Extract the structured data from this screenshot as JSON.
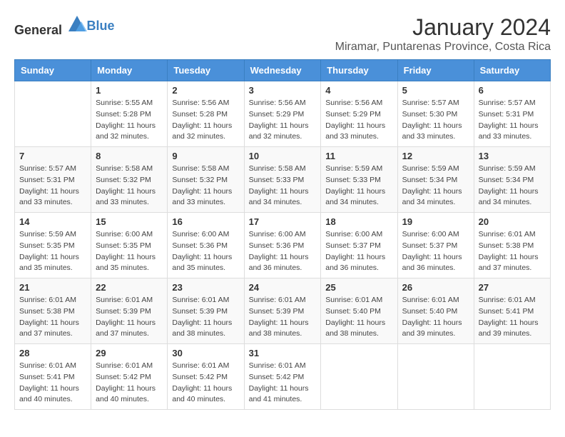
{
  "header": {
    "logo_general": "General",
    "logo_blue": "Blue",
    "month_title": "January 2024",
    "location": "Miramar, Puntarenas Province, Costa Rica"
  },
  "days_of_week": [
    "Sunday",
    "Monday",
    "Tuesday",
    "Wednesday",
    "Thursday",
    "Friday",
    "Saturday"
  ],
  "weeks": [
    [
      {
        "day": "",
        "info": ""
      },
      {
        "day": "1",
        "info": "Sunrise: 5:55 AM\nSunset: 5:28 PM\nDaylight: 11 hours\nand 32 minutes."
      },
      {
        "day": "2",
        "info": "Sunrise: 5:56 AM\nSunset: 5:28 PM\nDaylight: 11 hours\nand 32 minutes."
      },
      {
        "day": "3",
        "info": "Sunrise: 5:56 AM\nSunset: 5:29 PM\nDaylight: 11 hours\nand 32 minutes."
      },
      {
        "day": "4",
        "info": "Sunrise: 5:56 AM\nSunset: 5:29 PM\nDaylight: 11 hours\nand 33 minutes."
      },
      {
        "day": "5",
        "info": "Sunrise: 5:57 AM\nSunset: 5:30 PM\nDaylight: 11 hours\nand 33 minutes."
      },
      {
        "day": "6",
        "info": "Sunrise: 5:57 AM\nSunset: 5:31 PM\nDaylight: 11 hours\nand 33 minutes."
      }
    ],
    [
      {
        "day": "7",
        "info": "Sunrise: 5:57 AM\nSunset: 5:31 PM\nDaylight: 11 hours\nand 33 minutes."
      },
      {
        "day": "8",
        "info": "Sunrise: 5:58 AM\nSunset: 5:32 PM\nDaylight: 11 hours\nand 33 minutes."
      },
      {
        "day": "9",
        "info": "Sunrise: 5:58 AM\nSunset: 5:32 PM\nDaylight: 11 hours\nand 33 minutes."
      },
      {
        "day": "10",
        "info": "Sunrise: 5:58 AM\nSunset: 5:33 PM\nDaylight: 11 hours\nand 34 minutes."
      },
      {
        "day": "11",
        "info": "Sunrise: 5:59 AM\nSunset: 5:33 PM\nDaylight: 11 hours\nand 34 minutes."
      },
      {
        "day": "12",
        "info": "Sunrise: 5:59 AM\nSunset: 5:34 PM\nDaylight: 11 hours\nand 34 minutes."
      },
      {
        "day": "13",
        "info": "Sunrise: 5:59 AM\nSunset: 5:34 PM\nDaylight: 11 hours\nand 34 minutes."
      }
    ],
    [
      {
        "day": "14",
        "info": "Sunrise: 5:59 AM\nSunset: 5:35 PM\nDaylight: 11 hours\nand 35 minutes."
      },
      {
        "day": "15",
        "info": "Sunrise: 6:00 AM\nSunset: 5:35 PM\nDaylight: 11 hours\nand 35 minutes."
      },
      {
        "day": "16",
        "info": "Sunrise: 6:00 AM\nSunset: 5:36 PM\nDaylight: 11 hours\nand 35 minutes."
      },
      {
        "day": "17",
        "info": "Sunrise: 6:00 AM\nSunset: 5:36 PM\nDaylight: 11 hours\nand 36 minutes."
      },
      {
        "day": "18",
        "info": "Sunrise: 6:00 AM\nSunset: 5:37 PM\nDaylight: 11 hours\nand 36 minutes."
      },
      {
        "day": "19",
        "info": "Sunrise: 6:00 AM\nSunset: 5:37 PM\nDaylight: 11 hours\nand 36 minutes."
      },
      {
        "day": "20",
        "info": "Sunrise: 6:01 AM\nSunset: 5:38 PM\nDaylight: 11 hours\nand 37 minutes."
      }
    ],
    [
      {
        "day": "21",
        "info": "Sunrise: 6:01 AM\nSunset: 5:38 PM\nDaylight: 11 hours\nand 37 minutes."
      },
      {
        "day": "22",
        "info": "Sunrise: 6:01 AM\nSunset: 5:39 PM\nDaylight: 11 hours\nand 37 minutes."
      },
      {
        "day": "23",
        "info": "Sunrise: 6:01 AM\nSunset: 5:39 PM\nDaylight: 11 hours\nand 38 minutes."
      },
      {
        "day": "24",
        "info": "Sunrise: 6:01 AM\nSunset: 5:39 PM\nDaylight: 11 hours\nand 38 minutes."
      },
      {
        "day": "25",
        "info": "Sunrise: 6:01 AM\nSunset: 5:40 PM\nDaylight: 11 hours\nand 38 minutes."
      },
      {
        "day": "26",
        "info": "Sunrise: 6:01 AM\nSunset: 5:40 PM\nDaylight: 11 hours\nand 39 minutes."
      },
      {
        "day": "27",
        "info": "Sunrise: 6:01 AM\nSunset: 5:41 PM\nDaylight: 11 hours\nand 39 minutes."
      }
    ],
    [
      {
        "day": "28",
        "info": "Sunrise: 6:01 AM\nSunset: 5:41 PM\nDaylight: 11 hours\nand 40 minutes."
      },
      {
        "day": "29",
        "info": "Sunrise: 6:01 AM\nSunset: 5:42 PM\nDaylight: 11 hours\nand 40 minutes."
      },
      {
        "day": "30",
        "info": "Sunrise: 6:01 AM\nSunset: 5:42 PM\nDaylight: 11 hours\nand 40 minutes."
      },
      {
        "day": "31",
        "info": "Sunrise: 6:01 AM\nSunset: 5:42 PM\nDaylight: 11 hours\nand 41 minutes."
      },
      {
        "day": "",
        "info": ""
      },
      {
        "day": "",
        "info": ""
      },
      {
        "day": "",
        "info": ""
      }
    ]
  ]
}
